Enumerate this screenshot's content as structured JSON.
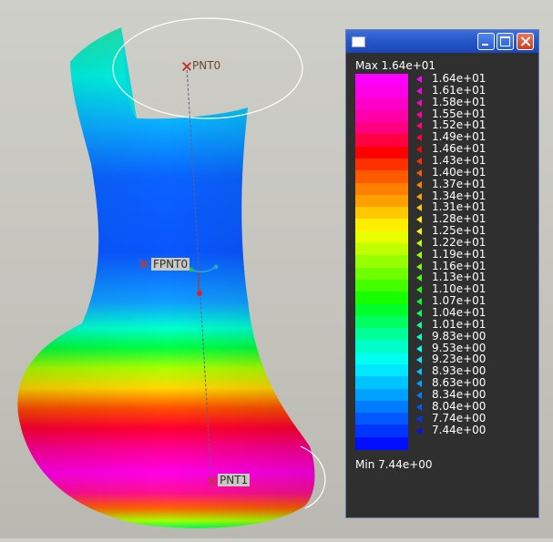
{
  "scene": {
    "points": [
      {
        "name": "PNT0"
      },
      {
        "name": "FPNT0"
      },
      {
        "name": "PNT1"
      }
    ]
  },
  "legend_window": {
    "max_label": "Max  1.64e+01",
    "min_label": "Min  7.44e+00",
    "values": [
      "1.64e+01",
      "1.61e+01",
      "1.58e+01",
      "1.55e+01",
      "1.52e+01",
      "1.49e+01",
      "1.46e+01",
      "1.43e+01",
      "1.40e+01",
      "1.37e+01",
      "1.34e+01",
      "1.31e+01",
      "1.28e+01",
      "1.25e+01",
      "1.22e+01",
      "1.19e+01",
      "1.16e+01",
      "1.13e+01",
      "1.10e+01",
      "1.07e+01",
      "1.04e+01",
      "1.01e+01",
      "9.83e+00",
      "9.53e+00",
      "9.23e+00",
      "8.93e+00",
      "8.63e+00",
      "8.34e+00",
      "8.04e+00",
      "7.74e+00",
      "7.44e+00"
    ],
    "band_colors": [
      "#ff00ff",
      "#ff00e6",
      "#ff00c8",
      "#ff00a8",
      "#ff0080",
      "#ff0040",
      "#ff0000",
      "#ff3000",
      "#ff5a00",
      "#ff8000",
      "#ffa000",
      "#ffc800",
      "#ffee00",
      "#e8ff00",
      "#c0ff00",
      "#98ff00",
      "#70ff00",
      "#44ff00",
      "#18ff00",
      "#00ff2a",
      "#00ff60",
      "#00ff96",
      "#00ffc8",
      "#00ffee",
      "#00e8ff",
      "#00c4ff",
      "#00a0ff",
      "#007cff",
      "#0058ff",
      "#0034ff",
      "#0010ff"
    ]
  },
  "colors": {
    "legend_bg": "#2f2f2f",
    "titlebar": "#2456c8",
    "background": "#c6c6bf"
  }
}
